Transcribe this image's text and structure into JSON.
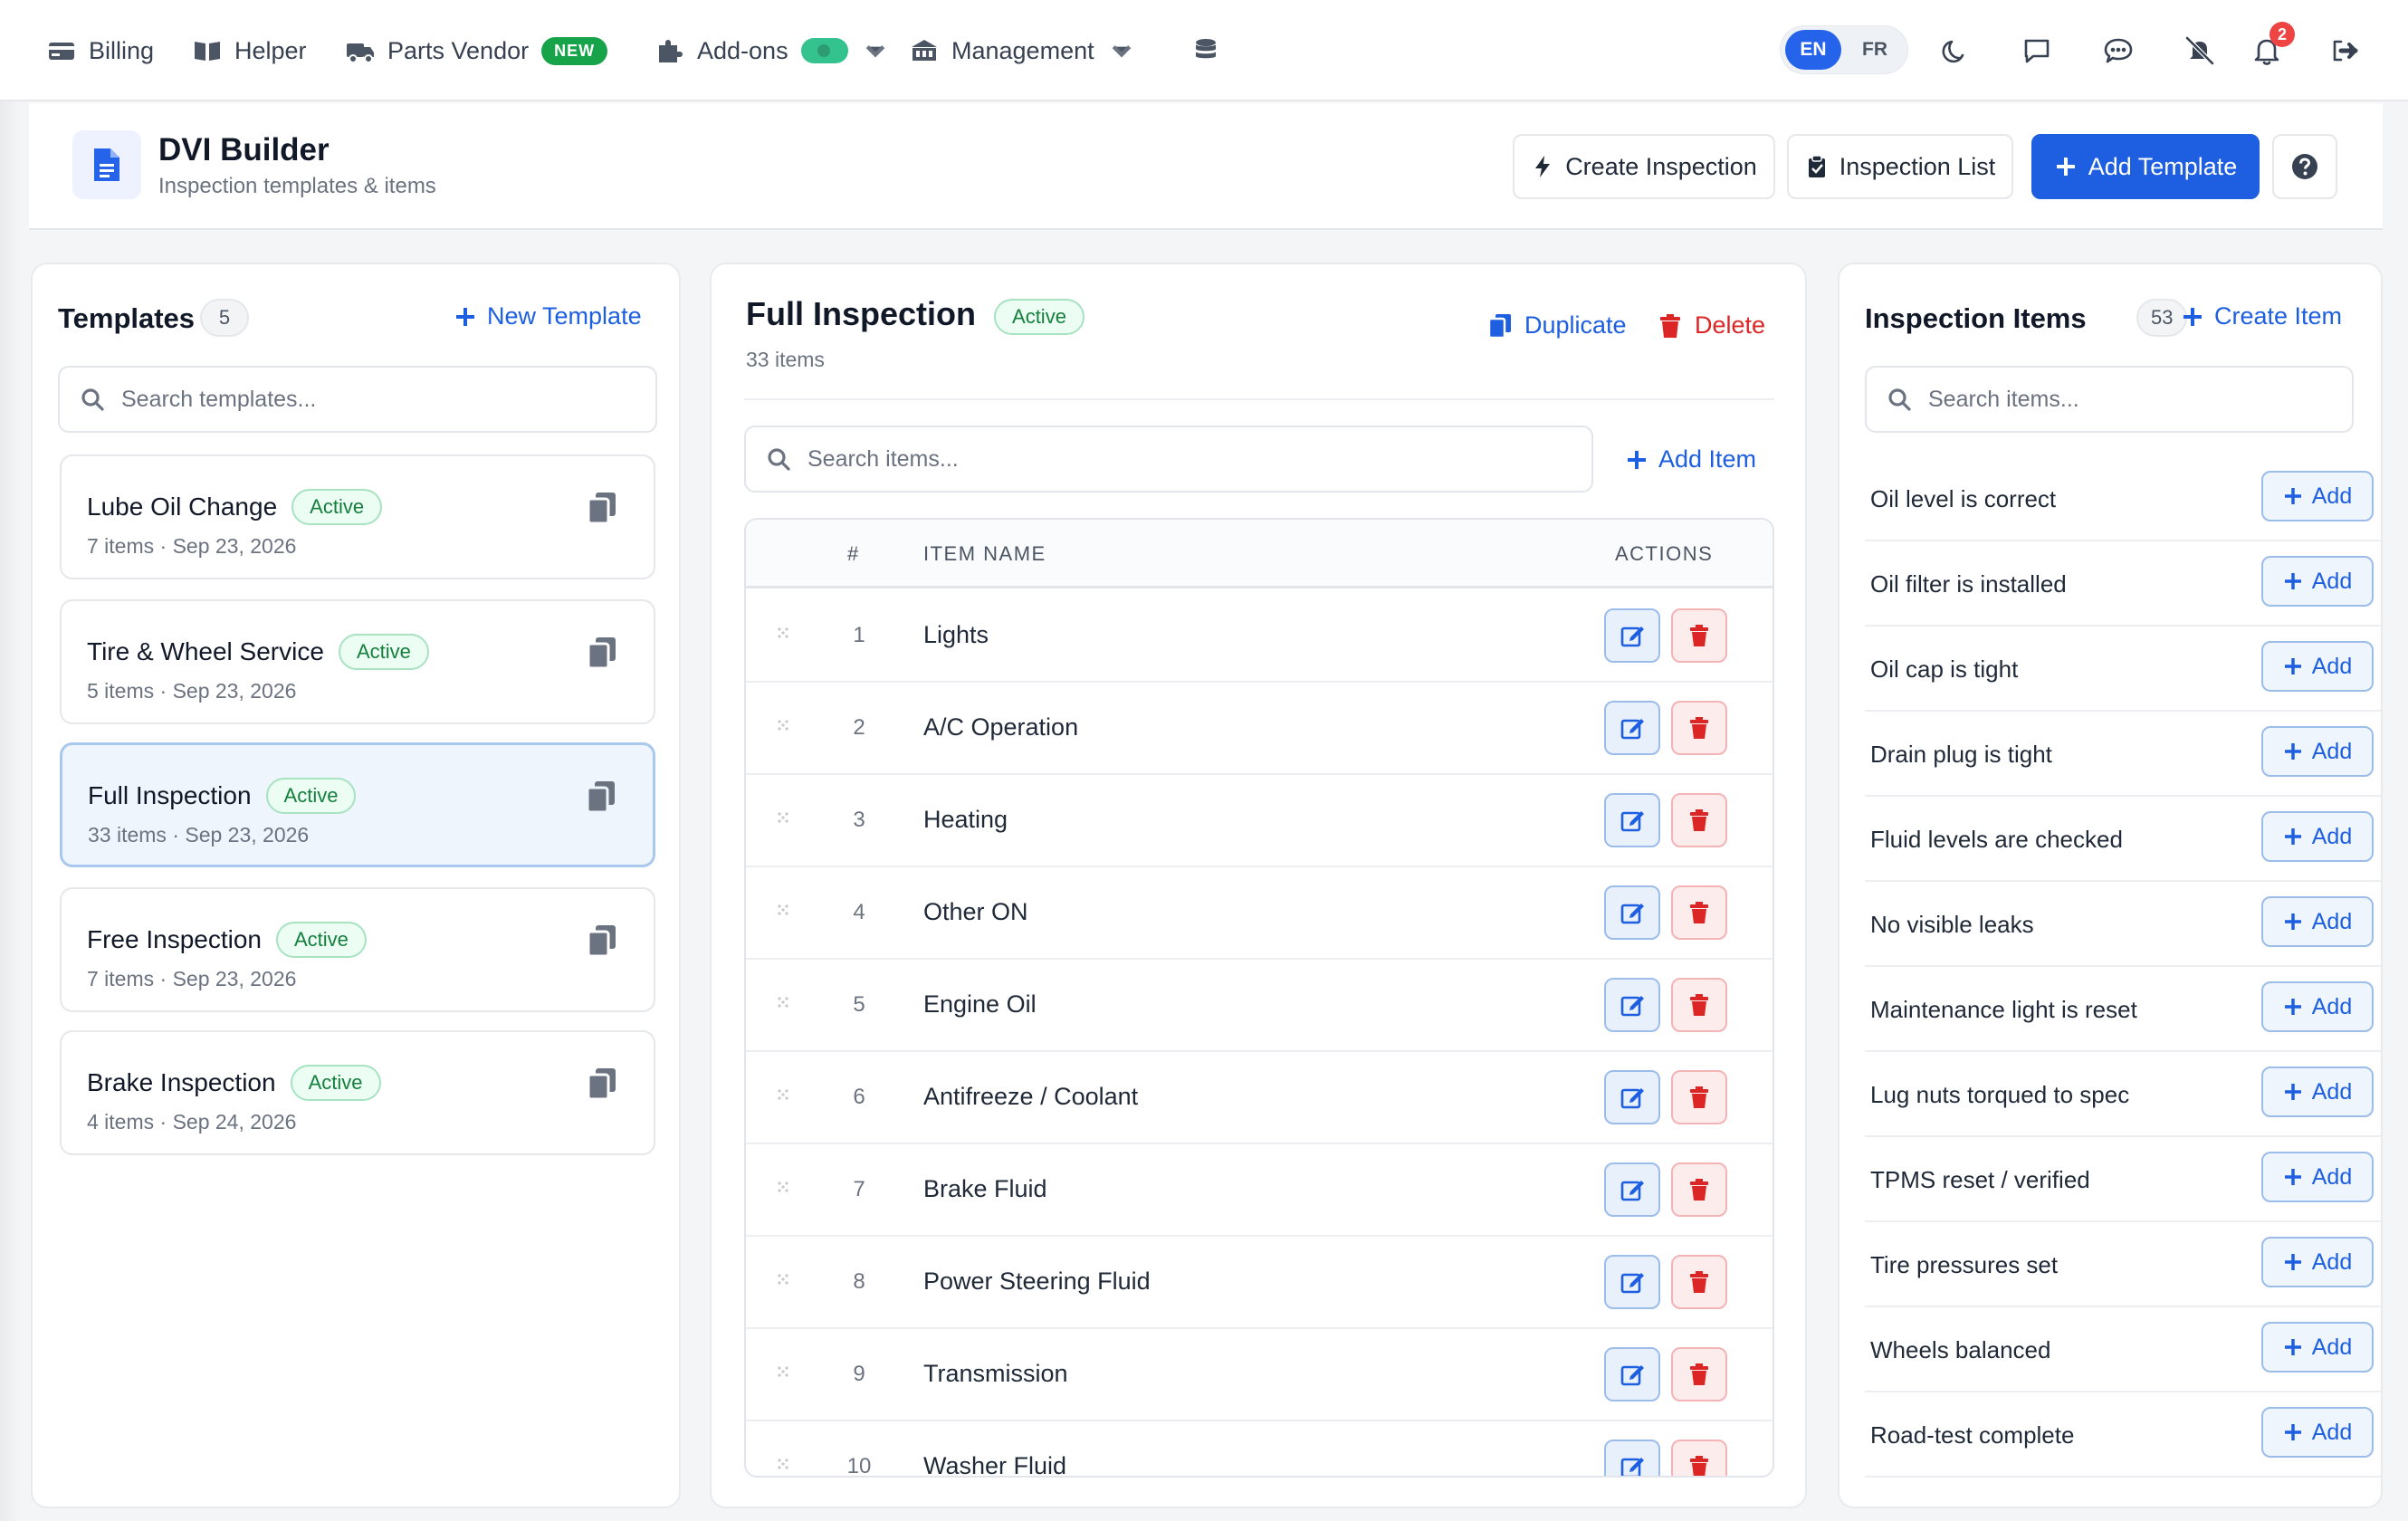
{
  "nav": {
    "billing": "Billing",
    "helper": "Helper",
    "parts_vendor": "Parts Vendor",
    "new_badge": "NEW",
    "addons": "Add-ons",
    "management": "Management",
    "lang_en": "EN",
    "lang_fr": "FR",
    "notification_count": "2"
  },
  "header": {
    "title": "DVI Builder",
    "subtitle": "Inspection templates & items",
    "create_inspection": "Create Inspection",
    "inspection_list": "Inspection List",
    "add_template": "Add Template"
  },
  "templates_panel": {
    "title": "Templates",
    "count": "5",
    "new_template": "New Template",
    "search_placeholder": "Search templates...",
    "items": [
      {
        "name": "Lube Oil Change",
        "status": "Active",
        "meta": "7 items · Sep 23, 2026"
      },
      {
        "name": "Tire & Wheel Service",
        "status": "Active",
        "meta": "5 items · Sep 23, 2026"
      },
      {
        "name": "Full Inspection",
        "status": "Active",
        "meta": "33 items · Sep 23, 2026"
      },
      {
        "name": "Free Inspection",
        "status": "Active",
        "meta": "7 items · Sep 23, 2026"
      },
      {
        "name": "Brake Inspection",
        "status": "Active",
        "meta": "4 items · Sep 24, 2026"
      }
    ]
  },
  "detail_panel": {
    "name": "Full Inspection",
    "status": "Active",
    "meta": "33 items",
    "duplicate": "Duplicate",
    "delete": "Delete",
    "search_placeholder": "Search items...",
    "add_item": "Add Item",
    "columns": {
      "num": "#",
      "name": "ITEM NAME",
      "actions": "ACTIONS"
    },
    "rows": [
      {
        "num": "1",
        "name": "Lights"
      },
      {
        "num": "2",
        "name": "A/C Operation"
      },
      {
        "num": "3",
        "name": "Heating"
      },
      {
        "num": "4",
        "name": "Other ON"
      },
      {
        "num": "5",
        "name": "Engine Oil"
      },
      {
        "num": "6",
        "name": "Antifreeze / Coolant"
      },
      {
        "num": "7",
        "name": "Brake Fluid"
      },
      {
        "num": "8",
        "name": "Power Steering Fluid"
      },
      {
        "num": "9",
        "name": "Transmission"
      },
      {
        "num": "10",
        "name": "Washer Fluid"
      }
    ]
  },
  "items_panel": {
    "title": "Inspection Items",
    "count": "53",
    "create_item": "Create Item",
    "search_placeholder": "Search items...",
    "add_label": "Add",
    "items": [
      "Oil level is correct",
      "Oil filter is installed",
      "Oil cap is tight",
      "Drain plug is tight",
      "Fluid levels are checked",
      "No visible leaks",
      "Maintenance light is reset",
      "Lug nuts torqued to spec",
      "TPMS reset / verified",
      "Tire pressures set",
      "Wheels balanced",
      "Road-test complete"
    ]
  },
  "colors": {
    "primary": "#1d5fe0",
    "success": "#15803d",
    "danger": "#dc2626",
    "badge_new": "#16a34a"
  }
}
